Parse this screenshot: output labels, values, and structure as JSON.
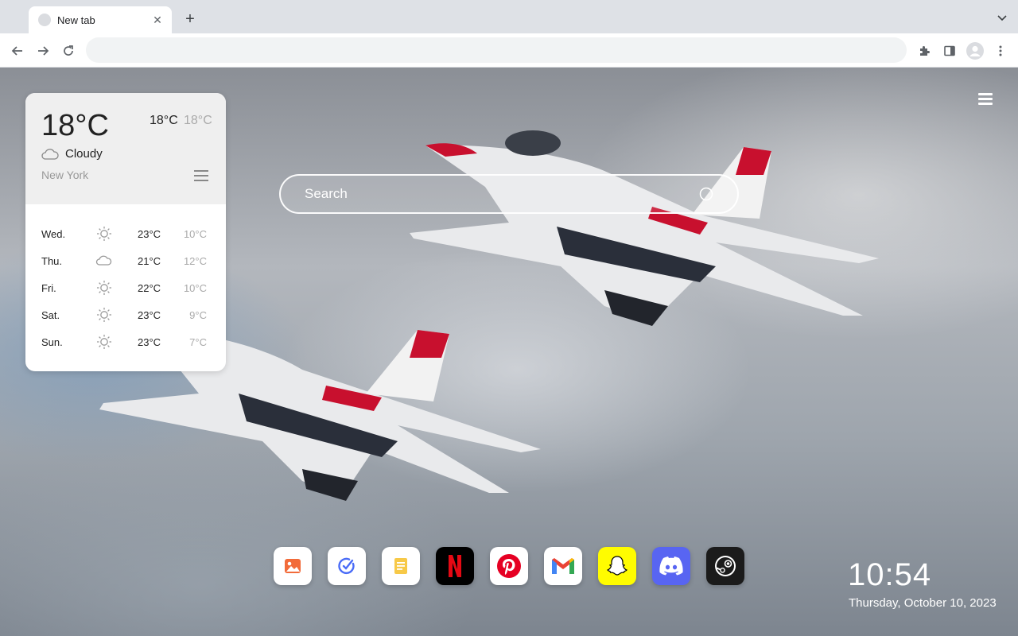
{
  "browser": {
    "tab_title": "New tab",
    "tab_close": "✕",
    "new_tab": "+",
    "omnibox_value": ""
  },
  "weather": {
    "current_temp": "18°C",
    "high": "18°C",
    "low": "18°C",
    "condition": "Cloudy",
    "city": "New York",
    "forecast": [
      {
        "day": "Wed.",
        "icon": "sun-icon",
        "high": "23°C",
        "low": "10°C"
      },
      {
        "day": "Thu.",
        "icon": "cloud-icon",
        "high": "21°C",
        "low": "12°C"
      },
      {
        "day": "Fri.",
        "icon": "sun-icon",
        "high": "22°C",
        "low": "10°C"
      },
      {
        "day": "Sat.",
        "icon": "sun-icon",
        "high": "23°C",
        "low": "9°C"
      },
      {
        "day": "Sun.",
        "icon": "sun-icon",
        "high": "23°C",
        "low": "7°C"
      }
    ]
  },
  "search": {
    "placeholder": "Search"
  },
  "shortcuts": [
    {
      "name": "photos-shortcut",
      "icon": "photo-icon",
      "bg": "#ffffff"
    },
    {
      "name": "tasks-shortcut",
      "icon": "check-circle-icon",
      "bg": "#ffffff"
    },
    {
      "name": "notes-shortcut",
      "icon": "note-icon",
      "bg": "#ffffff"
    },
    {
      "name": "netflix-shortcut",
      "icon": "netflix-icon",
      "bg": "#000000"
    },
    {
      "name": "pinterest-shortcut",
      "icon": "pinterest-icon",
      "bg": "#ffffff"
    },
    {
      "name": "gmail-shortcut",
      "icon": "gmail-icon",
      "bg": "#ffffff"
    },
    {
      "name": "snapchat-shortcut",
      "icon": "snapchat-icon",
      "bg": "#fffc00"
    },
    {
      "name": "discord-shortcut",
      "icon": "discord-icon",
      "bg": "#5865f2"
    },
    {
      "name": "steam-shortcut",
      "icon": "steam-icon",
      "bg": "#1b1b1b"
    }
  ],
  "clock": {
    "time": "10:54",
    "date": "Thursday, October 10, 2023"
  }
}
